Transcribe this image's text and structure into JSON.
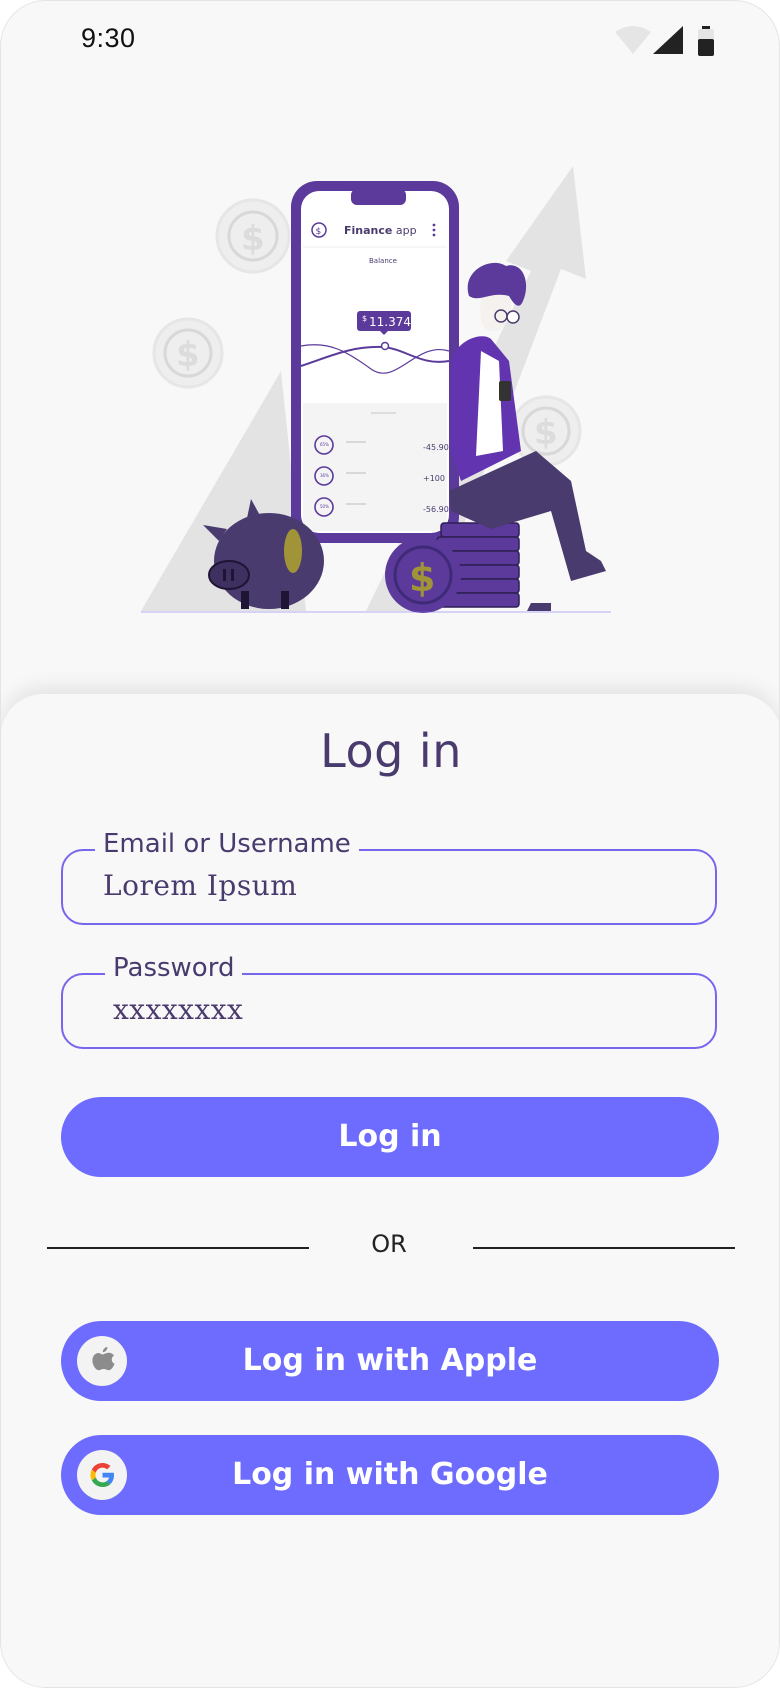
{
  "status_bar": {
    "time": "9:30"
  },
  "illustration": {
    "card_title_bold": "Finance",
    "card_title_rest": "app",
    "balance_label": "Balance",
    "balance_amount": "11.374",
    "currency_symbol": "$",
    "transactions": [
      "-45.90",
      "+100",
      "-56.90"
    ],
    "ring_labels": [
      "65%",
      "36%",
      "50%"
    ]
  },
  "login": {
    "title": "Log in",
    "email": {
      "label": "Email or Username",
      "value": "Lorem Ipsum"
    },
    "password": {
      "label": "Password",
      "value": "xxxxxxxx"
    },
    "login_button": "Log in",
    "divider_text": "OR",
    "apple_button": "Log in with Apple",
    "google_button": "Log in with Google"
  },
  "colors": {
    "accent": "#6d6cfe",
    "heading": "#4a3b6e",
    "field_border": "#7766ee",
    "illustration_purple": "#5b3a9b"
  },
  "icons": {
    "apple": "apple-icon",
    "google": "google-icon",
    "wifi": "wifi-icon",
    "signal": "signal-icon",
    "battery": "battery-icon"
  }
}
